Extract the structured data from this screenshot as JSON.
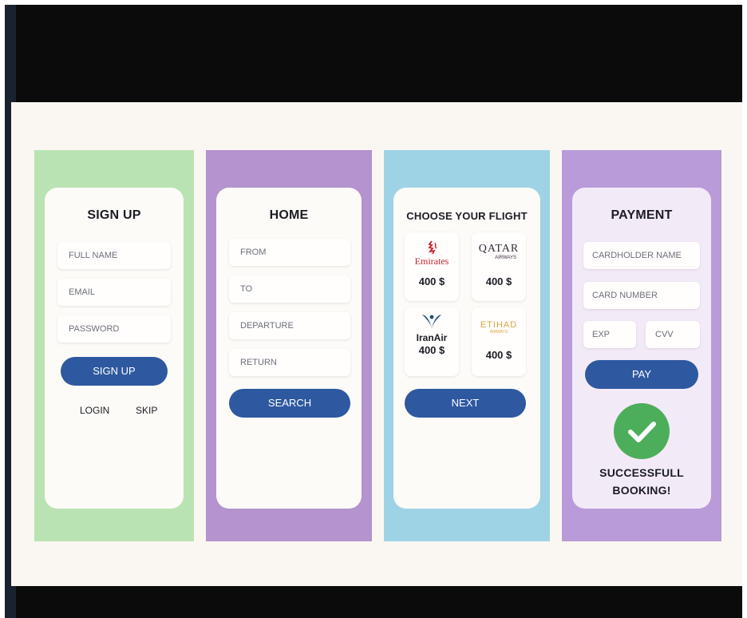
{
  "colors": {
    "signup_bg": "#b9e3b3",
    "home_bg": "#b493cf",
    "flight_bg": "#9ed3e6",
    "payment_bg": "#b89bd8",
    "button": "#2e58a0",
    "success": "#4cae5a"
  },
  "signup": {
    "title": "SIGN UP",
    "full_name_placeholder": "FULL NAME",
    "email_placeholder": "EMAIL",
    "password_placeholder": "PASSWORD",
    "button": "SIGN UP",
    "login": "LOGIN",
    "skip": "SKIP"
  },
  "home": {
    "title": "HOME",
    "from_placeholder": "FROM",
    "to_placeholder": "TO",
    "departure_placeholder": "DEPARTURE",
    "return_placeholder": "RETURN",
    "button": "SEARCH"
  },
  "flights": {
    "title": "CHOOSE YOUR FLIGHT",
    "options": [
      {
        "airline": "Emirates",
        "price": "400 $",
        "logo_icon": "emirates-logo-icon"
      },
      {
        "airline": "QATAR",
        "subline": "AIRWAYS",
        "price": "400 $",
        "logo_icon": "qatar-logo-icon"
      },
      {
        "airline": "IranAir",
        "price": "400 $",
        "logo_icon": "iranair-logo-icon"
      },
      {
        "airline": "ETIHAD",
        "subline": "AIRWAYS",
        "price": "400 $",
        "logo_icon": "etihad-logo-icon"
      }
    ],
    "button": "NEXT"
  },
  "payment": {
    "title": "PAYMENT",
    "cardholder_placeholder": "CARDHOLDER NAME",
    "card_number_placeholder": "CARD NUMBER",
    "exp_placeholder": "EXP",
    "cvv_placeholder": "CVV",
    "button": "PAY",
    "success_icon": "check-circle-icon",
    "success_line1": "SUCCESSFULL",
    "success_line2": "BOOKING!"
  }
}
